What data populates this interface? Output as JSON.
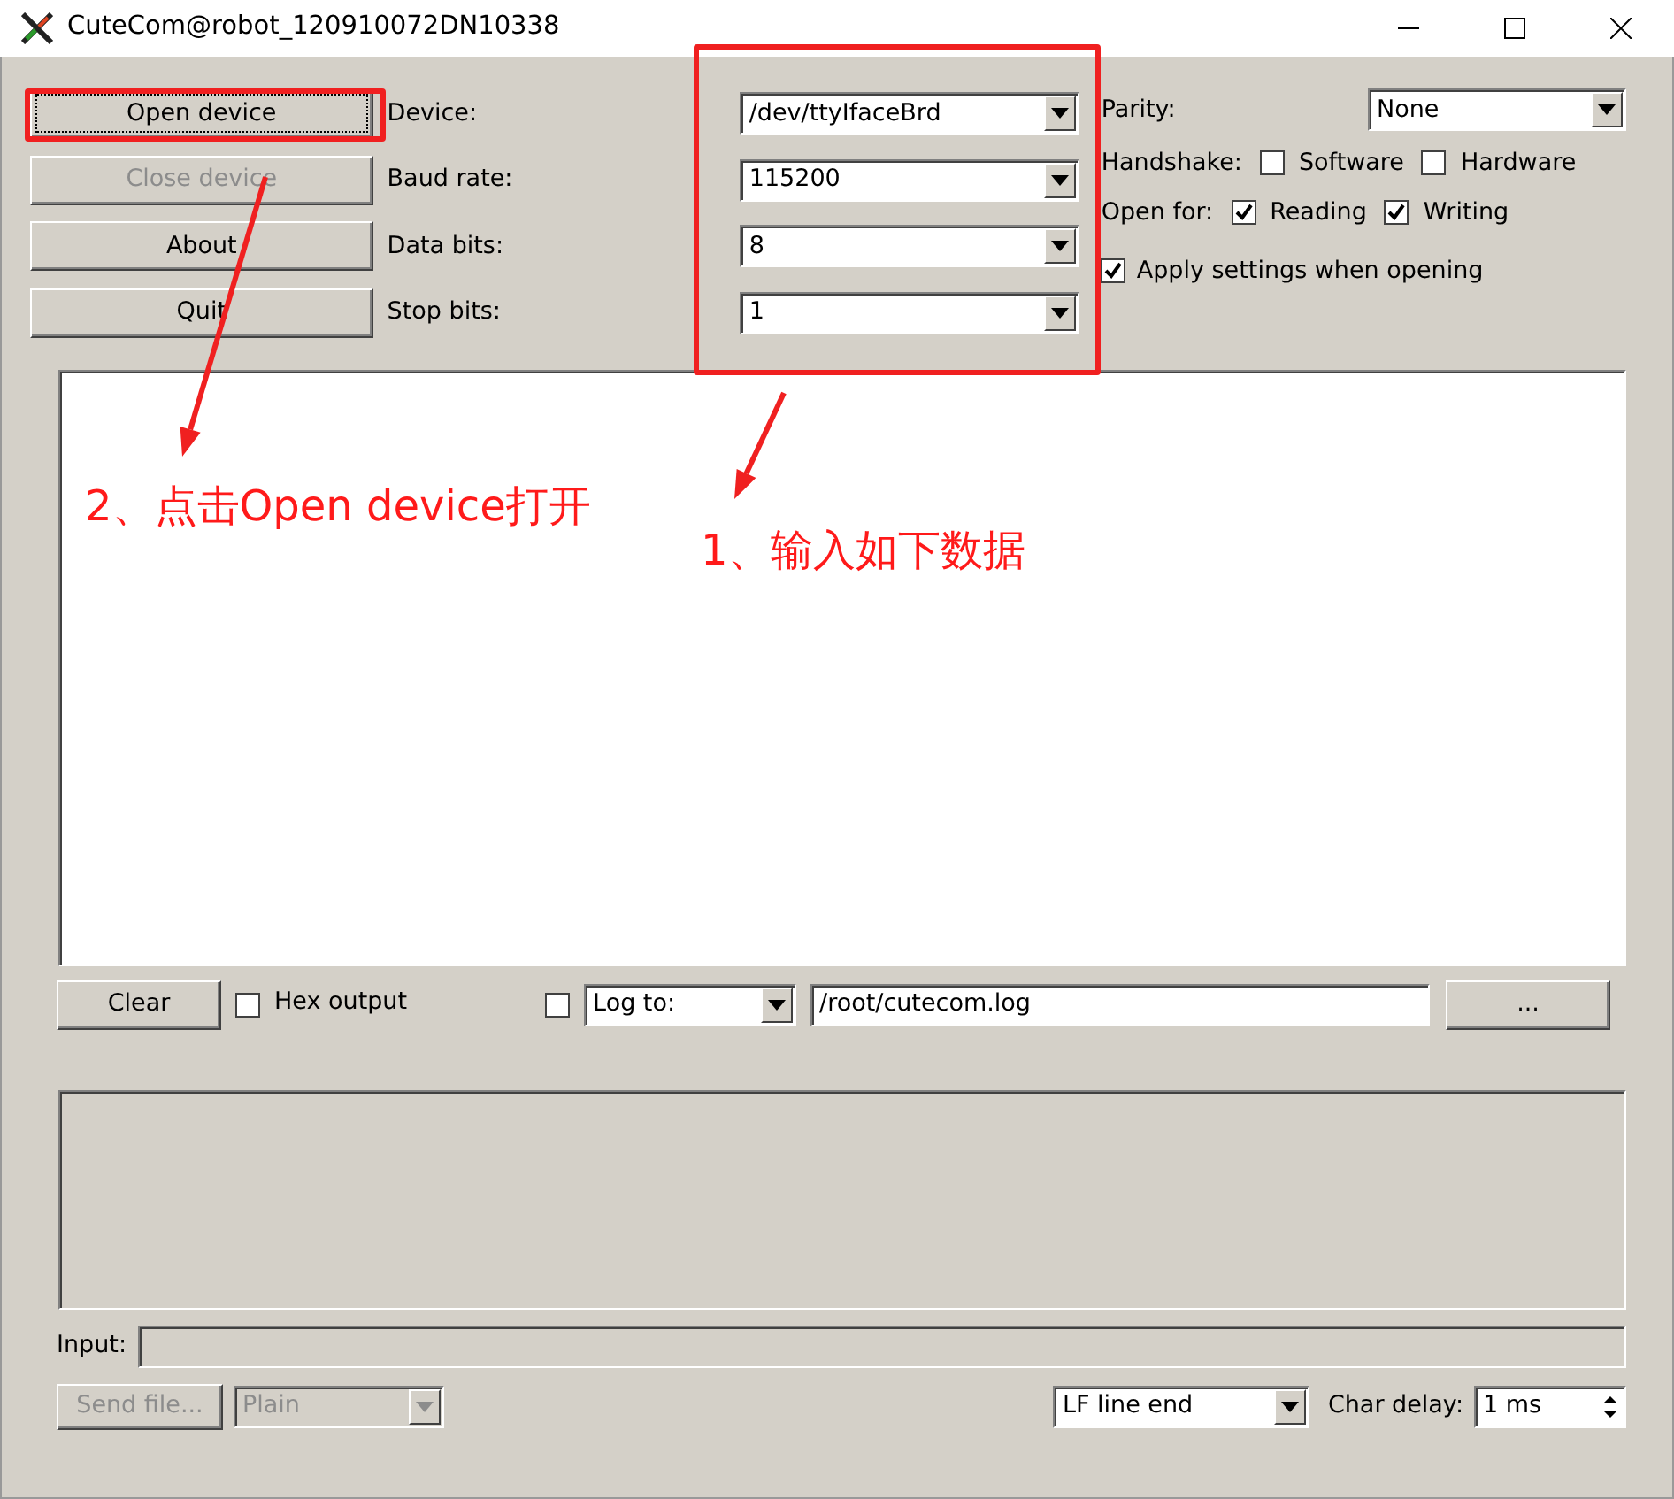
{
  "window": {
    "title": "CuteCom@robot_120910072DN10338"
  },
  "buttons": [
    {
      "label": "Open device",
      "disabled": false
    },
    {
      "label": "Close device",
      "disabled": true
    },
    {
      "label": "About",
      "disabled": false
    },
    {
      "label": "Quit",
      "disabled": false
    }
  ],
  "settings": [
    {
      "label": "Device:",
      "value": "/dev/ttyIfaceBrd"
    },
    {
      "label": "Baud rate:",
      "value": "115200"
    },
    {
      "label": "Data bits:",
      "value": "8"
    },
    {
      "label": "Stop bits:",
      "value": "1"
    }
  ],
  "parity": {
    "label": "Parity:",
    "value": "None"
  },
  "handshake": {
    "label": "Handshake:",
    "options": [
      {
        "label": "Software",
        "checked": false
      },
      {
        "label": "Hardware",
        "checked": false
      }
    ]
  },
  "open_for": {
    "label": "Open for:",
    "options": [
      {
        "label": "Reading",
        "checked": true
      },
      {
        "label": "Writing",
        "checked": true
      }
    ]
  },
  "apply_settings": {
    "label": "Apply settings when opening",
    "checked": true
  },
  "output_toolbar": {
    "clear": "Clear",
    "hex_output": {
      "label": "Hex output",
      "checked": false
    },
    "log_enabled": {
      "checked": false
    },
    "log_mode": "Log to:",
    "log_path": "/root/cutecom.log",
    "browse": "..."
  },
  "input": {
    "label": "Input:"
  },
  "bottom_bar": {
    "send_file": {
      "label": "Send file...",
      "disabled": true
    },
    "send_mode": {
      "value": "Plain",
      "disabled": true
    },
    "line_end": "LF line end",
    "char_delay": {
      "label": "Char delay:",
      "value": "1 ms"
    }
  },
  "annotations": [
    {
      "kind": "box"
    },
    {
      "kind": "box"
    },
    {
      "kind": "arrow"
    },
    {
      "kind": "arrow"
    },
    {
      "kind": "note",
      "text": "2、点击Open device打开"
    },
    {
      "kind": "note",
      "text": "1、输入如下数据"
    }
  ]
}
